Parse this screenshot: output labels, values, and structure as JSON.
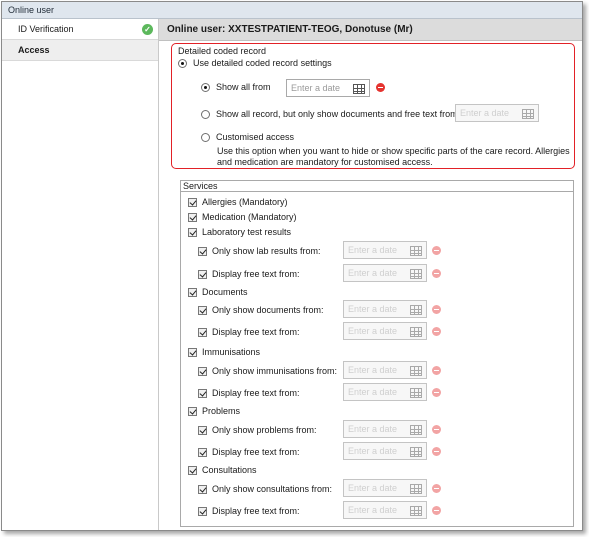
{
  "window": {
    "title": "Online user"
  },
  "sidebar": {
    "items": [
      {
        "label": "ID Verification",
        "status_icon": "check-circle-icon"
      },
      {
        "label": "Access"
      }
    ]
  },
  "header": {
    "title": "Online user: XXTESTPATIENT-TEOG, Donotuse (Mr)"
  },
  "coded_record": {
    "legend": "Detailed coded record",
    "use_detailed_label": "Use detailed coded record settings",
    "show_all_from_label": "Show all from",
    "show_all_from_placeholder": "Enter a date",
    "show_all_docs_label": "Show all record, but only show documents and free text from",
    "show_all_docs_placeholder": "Enter a date",
    "customised_label": "Customised access",
    "customised_description": "Use this option when you want to hide or show specific parts of the care record. Allergies and medication are mandatory for customised access.",
    "selected_option": "show_all_from"
  },
  "services": {
    "legend": "Services",
    "date_placeholder": "Enter a date",
    "allergies": "Allergies (Mandatory)",
    "medication": "Medication (Mandatory)",
    "lab": {
      "label": "Laboratory test results",
      "only_show": "Only show lab results from:",
      "free_text": "Display free text from:"
    },
    "documents": {
      "label": "Documents",
      "only_show": "Only show documents from:",
      "free_text": "Display free text from:"
    },
    "immunisations": {
      "label": "Immunisations",
      "only_show": "Only show immunisations from:",
      "free_text": "Display free text from:"
    },
    "problems": {
      "label": "Problems",
      "only_show": "Only show problems from:",
      "free_text": "Display free text from:"
    },
    "consultations": {
      "label": "Consultations",
      "only_show": "Only show consultations from:",
      "free_text": "Display free text from:"
    }
  },
  "colors": {
    "highlight_border": "#e22127",
    "header_bg": "#dcdcdc",
    "verified_green": "#5cb85c",
    "clear_red": "#e5332f"
  }
}
